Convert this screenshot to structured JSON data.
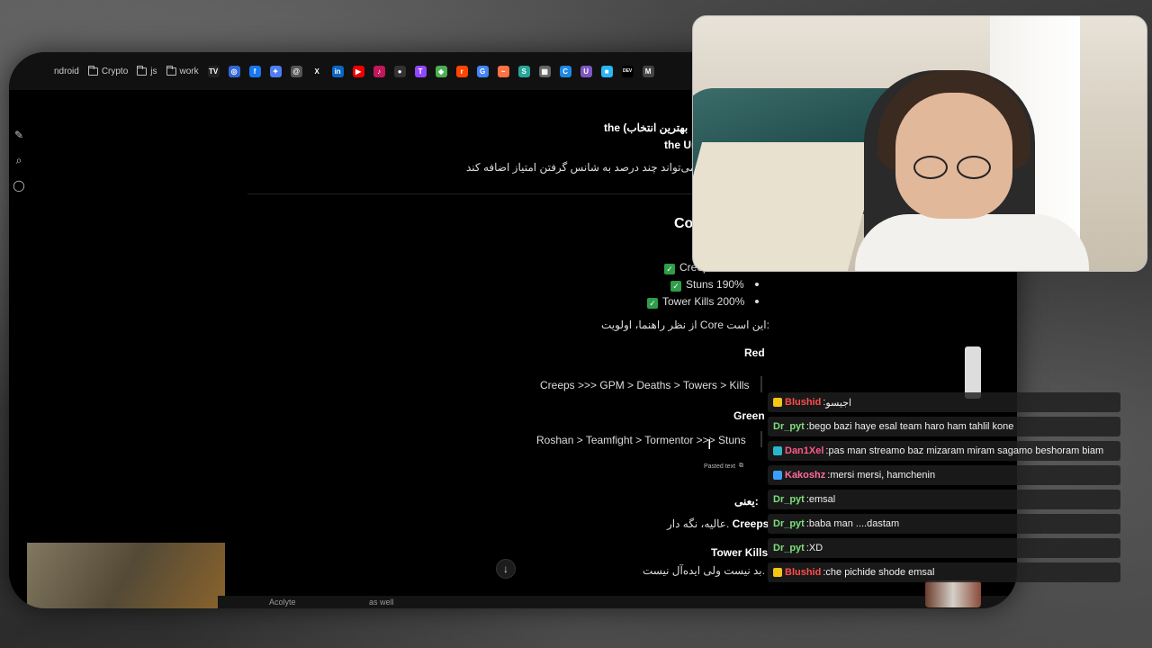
{
  "bookmarks": [
    {
      "label": "ndroid",
      "icon": "folder-icon"
    },
    {
      "label": "Crypto",
      "icon": "folder-icon"
    },
    {
      "label": "js",
      "icon": "folder-icon"
    },
    {
      "label": "work",
      "icon": "folder-icon"
    }
  ],
  "bookmark_icons": [
    {
      "name": "tradingview-icon",
      "glyph": "TV",
      "color": "#222"
    },
    {
      "name": "chrome-icon",
      "glyph": "◎",
      "color": "#3367d6"
    },
    {
      "name": "facebook-icon",
      "glyph": "f",
      "color": "#1877f2"
    },
    {
      "name": "gemini-icon",
      "glyph": "✦",
      "color": "#4f7df3"
    },
    {
      "name": "threads-icon",
      "glyph": "@",
      "color": "#555"
    },
    {
      "name": "x-icon",
      "glyph": "X",
      "color": "#111"
    },
    {
      "name": "linkedin-icon",
      "glyph": "in",
      "color": "#0a66c2"
    },
    {
      "name": "youtube-icon",
      "glyph": "▶",
      "color": "#e00"
    },
    {
      "name": "app-red-icon",
      "glyph": "♪",
      "color": "#c2185b"
    },
    {
      "name": "github-icon",
      "glyph": "●",
      "color": "#333"
    },
    {
      "name": "twitch-icon",
      "glyph": "T",
      "color": "#9146ff"
    },
    {
      "name": "bookmark-green-icon",
      "glyph": "◆",
      "color": "#4caf50"
    },
    {
      "name": "reddit-icon",
      "glyph": "r",
      "color": "#ff4500"
    },
    {
      "name": "translate-icon",
      "glyph": "G",
      "color": "#4285f4"
    },
    {
      "name": "chart-icon",
      "glyph": "~",
      "color": "#ff7043"
    },
    {
      "name": "tools-icon",
      "glyph": "S",
      "color": "#26a69a"
    },
    {
      "name": "grid-icon",
      "glyph": "▦",
      "color": "#666"
    },
    {
      "name": "coingecko-icon",
      "glyph": "C",
      "color": "#1e88e5"
    },
    {
      "name": "purple-app-icon",
      "glyph": "U",
      "color": "#7e57c2"
    },
    {
      "name": "chat-icon",
      "glyph": "■",
      "color": "#29b6f6"
    },
    {
      "name": "dev-icon",
      "glyph": "DEV",
      "color": "#000"
    },
    {
      "name": "medium-icon",
      "glyph": "M",
      "color": "#444"
    }
  ],
  "content": {
    "line1": "the (بهترین انتخاب",
    "line2": "the Ur",
    "line3": "می‌تواند چند درصد به شانس گرفتن امتیاز اضافه کند.",
    "heading": "Co",
    "check1": "Creep",
    "check2": "Stuns 190%",
    "check3": "Tower Kills 200%",
    "priority": "از نظر راهنما، اولویت Core این است:",
    "red": "Red",
    "red_order": "Creeps >>> GPM > Deaths > Towers > Kills",
    "green": "Green",
    "green_order": "Roshan > Teamfight > Tormentor >>> Stuns",
    "pasted": "Pasted text",
    "meaning": "یعنی:",
    "creeps_label": "Creeps",
    "creeps_text": "عالیه، نگه دار.",
    "tower_kills": "Tower Kills",
    "tower_text": "بد نیست ولی ایده‌آل نیست.",
    "footer1": "Acolyte",
    "footer2": "as well"
  },
  "chat": [
    {
      "user": "Blushid",
      "color": "#ff4d4d",
      "badge": "#f5c518",
      "text": "اجیسو"
    },
    {
      "user": "Dr_pyt",
      "color": "#7be07b",
      "badge": "",
      "text": "bego bazi haye esal team haro ham tahlil kone"
    },
    {
      "user": "Dan1Xel",
      "color": "#ff5a8a",
      "badge": "#2ab7ca",
      "text": "pas man streamo baz mizaram miram sagamo beshoram biam"
    },
    {
      "user": "Kakoshz",
      "color": "#ff6b9a",
      "badge": "#3aa0ff",
      "text": "mersi mersi, hamchenin"
    },
    {
      "user": "Dr_pyt",
      "color": "#7be07b",
      "badge": "",
      "text": "emsal"
    },
    {
      "user": "Dr_pyt",
      "color": "#7be07b",
      "badge": "",
      "text": "baba man ....dastam"
    },
    {
      "user": "Dr_pyt",
      "color": "#7be07b",
      "badge": "",
      "text": "XD"
    },
    {
      "user": "Blushid",
      "color": "#ff4d4d",
      "badge": "#f5c518",
      "text": "che pichide shode emsal"
    }
  ]
}
